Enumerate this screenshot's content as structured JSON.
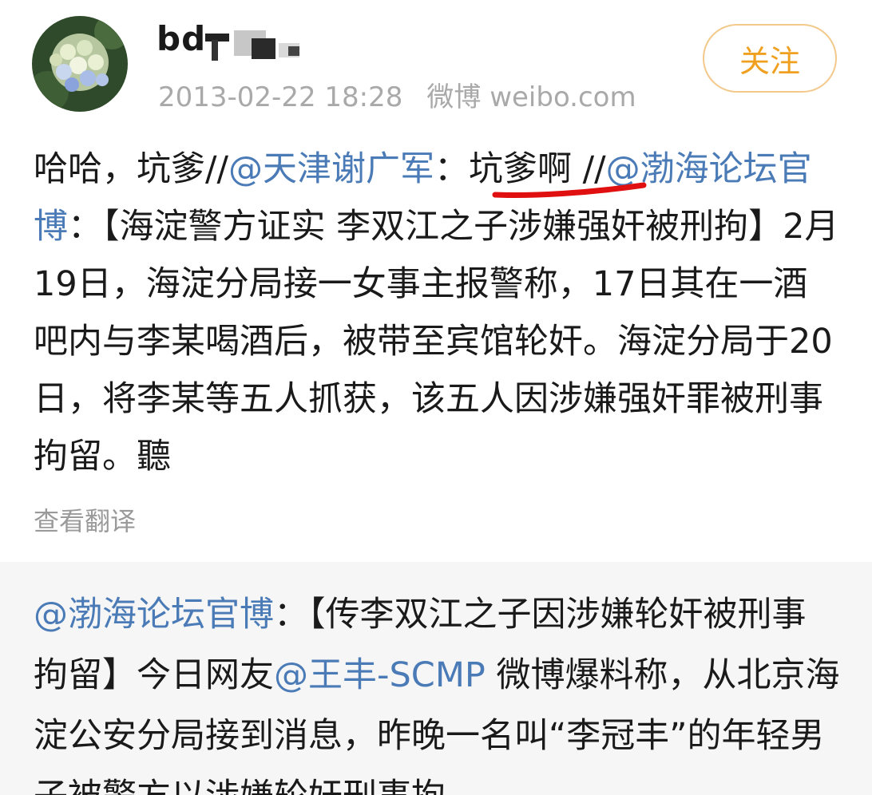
{
  "header": {
    "username_visible": "bd",
    "timestamp": "2013-02-22 18:28",
    "source": "微博 weibo.com",
    "follow_label": "关注"
  },
  "post": {
    "part1": "哈哈，坑爹//",
    "mention1": "@天津谢广军",
    "part2": "：",
    "part3": "坑爹啊",
    "part4": " //",
    "mention2": "@渤海论坛官博",
    "part5": "：【海淀警方证实 李双江之子涉嫌强奸被刑拘】2月19日，海淀分局接一女事主报警称，17日其在一酒吧内与李某喝酒后，被带至宾馆轮奸。海淀分局于20日，将李某等五人抓获，该五人因涉嫌强奸罪被刑事拘留。聽",
    "translate_label": "查看翻译"
  },
  "quoted": {
    "mention1": "@渤海论坛官博",
    "part1": "：【传李双江之子因涉嫌轮奸被刑事拘留】今日网友",
    "mention2": "@王丰-SCMP",
    "part2": " 微博爆料称，从北京海淀公安分局接到消息，昨晚一名叫“李冠丰”的年轻男子被警方以涉嫌轮奸刑事拘"
  },
  "colors": {
    "mention": "#4a7bb7",
    "follow_border": "#f2c98a",
    "follow_text": "#f0a020",
    "underline": "#e01010",
    "quote_bg": "#f6f6f6"
  },
  "icons": {
    "avatar": "hydrangea-flower-avatar"
  }
}
